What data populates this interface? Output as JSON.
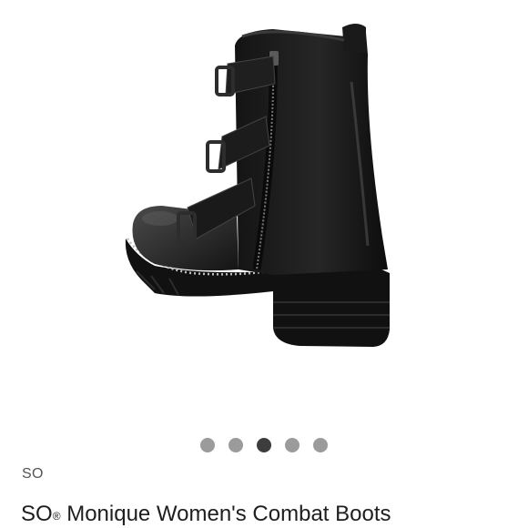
{
  "product": {
    "brand": "SO",
    "title_brand": "SO",
    "title_mark": "®",
    "title_rest": " Monique Women's Combat Boots",
    "image_alt": "Black combat boot with buckle straps and side zipper"
  },
  "carousel": {
    "total_slides": 5,
    "active_index": 2,
    "dot_color": "#9b9b9b",
    "active_dot_color": "#3d3d3d"
  }
}
